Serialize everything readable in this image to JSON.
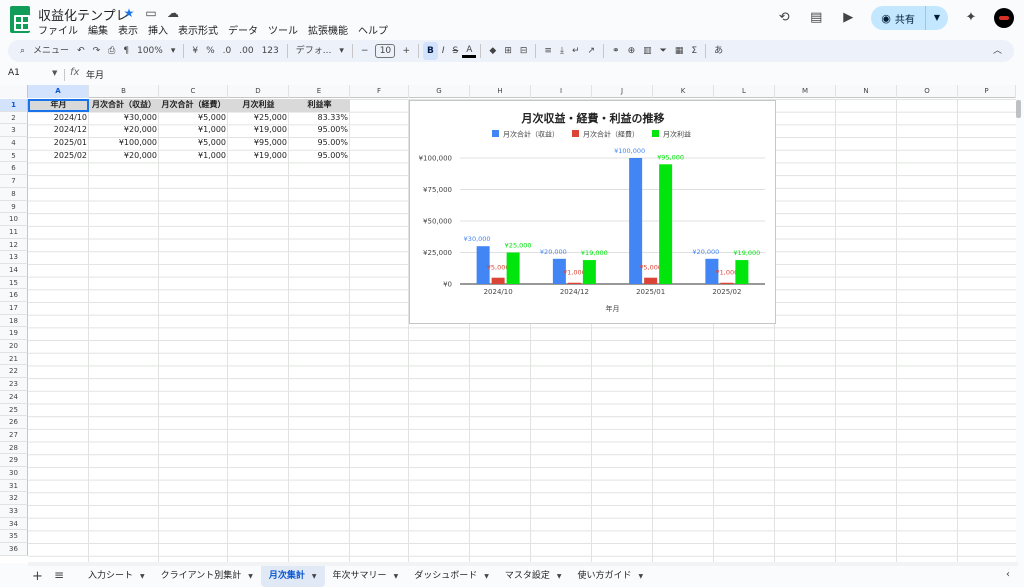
{
  "title_bar": {
    "doc_title": "収益化テンプレ",
    "menu": [
      "ファイル",
      "編集",
      "表示",
      "挿入",
      "表示形式",
      "データ",
      "ツール",
      "拡張機能",
      "ヘルプ"
    ],
    "share_label": "共有"
  },
  "toolbar": {
    "menu_search": "メニュー",
    "zoom": "100%",
    "currency": "¥",
    "percent": "%",
    "dec_decrease": ".0",
    "dec_increase": ".00",
    "number_format": "123",
    "font": "デフォ...",
    "font_size": "10",
    "bold": "B",
    "italic": "I",
    "strike": "S",
    "text_color": "A",
    "sigma": "Σ",
    "input_tool": "あ"
  },
  "formula_bar": {
    "cell_ref": "A1",
    "fx": "fx",
    "value": "年月"
  },
  "grid": {
    "columns": [
      "A",
      "B",
      "C",
      "D",
      "E",
      "F",
      "G",
      "H",
      "I",
      "J",
      "K",
      "L",
      "M",
      "N",
      "O",
      "P"
    ],
    "rows": [
      "1",
      "2",
      "3",
      "4",
      "5",
      "6",
      "7",
      "8",
      "9",
      "10",
      "11",
      "12",
      "13",
      "14",
      "15",
      "16",
      "17",
      "18",
      "19",
      "20",
      "21",
      "22",
      "23",
      "24",
      "25",
      "26",
      "27",
      "28",
      "29",
      "30",
      "31",
      "32",
      "33",
      "34",
      "35",
      "36"
    ],
    "headers": [
      "年月",
      "月次合計（収益）",
      "月次合計（経費）",
      "月次利益",
      "利益率"
    ],
    "table": [
      [
        "2024/10",
        "¥30,000",
        "¥5,000",
        "¥25,000",
        "83.33%"
      ],
      [
        "2024/12",
        "¥20,000",
        "¥1,000",
        "¥19,000",
        "95.00%"
      ],
      [
        "2025/01",
        "¥100,000",
        "¥5,000",
        "¥95,000",
        "95.00%"
      ],
      [
        "2025/02",
        "¥20,000",
        "¥1,000",
        "¥19,000",
        "95.00%"
      ]
    ]
  },
  "chart_data": {
    "type": "bar",
    "title": "月次収益・経費・利益の推移",
    "xlabel": "年月",
    "ylabel": "",
    "categories": [
      "2024/10",
      "2024/12",
      "2025/01",
      "2025/02"
    ],
    "series": [
      {
        "name": "月次合計（収益）",
        "color": "#4285f4",
        "values": [
          30000,
          20000,
          100000,
          20000
        ],
        "labels": [
          "¥30,000",
          "¥20,000",
          "¥100,000",
          "¥20,000"
        ]
      },
      {
        "name": "月次合計（経費）",
        "color": "#db4437",
        "values": [
          5000,
          1000,
          5000,
          1000
        ],
        "labels": [
          "¥5,000",
          "¥1,000",
          "¥5,000",
          "¥1,000"
        ]
      },
      {
        "name": "月次利益",
        "color": "#00e60c",
        "values": [
          25000,
          19000,
          95000,
          19000
        ],
        "labels": [
          "¥25,000",
          "¥19,000",
          "¥95,000",
          "¥19,000"
        ]
      }
    ],
    "yticks": [
      0,
      25000,
      50000,
      75000,
      100000
    ],
    "ytick_labels": [
      "¥0",
      "¥25,000",
      "¥50,000",
      "¥75,000",
      "¥100,000"
    ],
    "ylim": [
      0,
      100000
    ],
    "legend_position": "top",
    "grid": true
  },
  "sheet_tabs": [
    {
      "label": "入力シート",
      "active": false
    },
    {
      "label": "クライアント別集計",
      "active": false
    },
    {
      "label": "月次集計",
      "active": true
    },
    {
      "label": "年次サマリー",
      "active": false
    },
    {
      "label": "ダッシュボード",
      "active": false
    },
    {
      "label": "マスタ設定",
      "active": false
    },
    {
      "label": "使い方ガイド",
      "active": false
    }
  ]
}
